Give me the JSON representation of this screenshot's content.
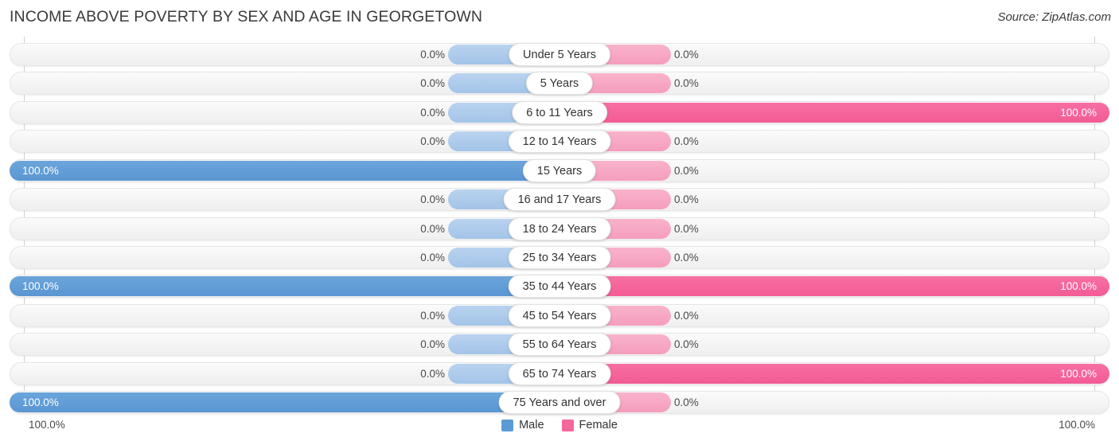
{
  "header": {
    "title": "INCOME ABOVE POVERTY BY SEX AND AGE IN GEORGETOWN",
    "source": "Source: ZipAtlas.com"
  },
  "legend": {
    "male_label": "Male",
    "female_label": "Female",
    "male_color": "#5b9bd5",
    "female_color": "#f4679b"
  },
  "axis": {
    "left_label": "100.0%",
    "right_label": "100.0%",
    "max": 100.0
  },
  "chart_data": {
    "type": "bar",
    "title": "INCOME ABOVE POVERTY BY SEX AND AGE IN GEORGETOWN",
    "orientation": "horizontal-diverging",
    "xlabel": "",
    "ylabel": "",
    "xlim": [
      0,
      100
    ],
    "grid": true,
    "legend_position": "bottom-center",
    "categories": [
      "Under 5 Years",
      "5 Years",
      "6 to 11 Years",
      "12 to 14 Years",
      "15 Years",
      "16 and 17 Years",
      "18 to 24 Years",
      "25 to 34 Years",
      "35 to 44 Years",
      "45 to 54 Years",
      "55 to 64 Years",
      "65 to 74 Years",
      "75 Years and over"
    ],
    "series": [
      {
        "name": "Male",
        "values": [
          0.0,
          0.0,
          0.0,
          0.0,
          100.0,
          0.0,
          0.0,
          0.0,
          100.0,
          0.0,
          0.0,
          0.0,
          100.0
        ],
        "labels": [
          "0.0%",
          "0.0%",
          "0.0%",
          "0.0%",
          "100.0%",
          "0.0%",
          "0.0%",
          "0.0%",
          "100.0%",
          "0.0%",
          "0.0%",
          "0.0%",
          "100.0%"
        ]
      },
      {
        "name": "Female",
        "values": [
          0.0,
          0.0,
          100.0,
          0.0,
          0.0,
          0.0,
          0.0,
          0.0,
          100.0,
          0.0,
          0.0,
          100.0,
          0.0
        ],
        "labels": [
          "0.0%",
          "0.0%",
          "100.0%",
          "0.0%",
          "0.0%",
          "0.0%",
          "0.0%",
          "0.0%",
          "100.0%",
          "0.0%",
          "0.0%",
          "100.0%",
          "0.0%"
        ]
      }
    ]
  }
}
